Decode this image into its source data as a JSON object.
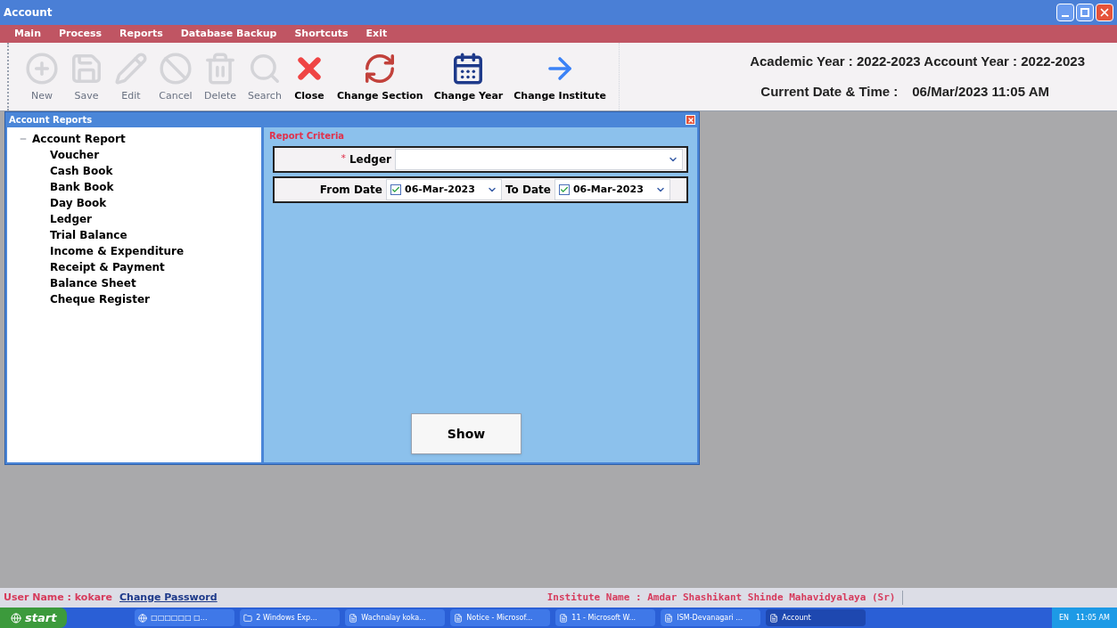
{
  "window": {
    "title": "Account"
  },
  "menu": [
    "Main",
    "Process",
    "Reports",
    "Database Backup",
    "Shortcuts",
    "Exit"
  ],
  "toolbar": [
    {
      "kind": "new",
      "label": "New",
      "disabled": true
    },
    {
      "kind": "save",
      "label": "Save",
      "disabled": true
    },
    {
      "kind": "edit",
      "label": "Edit",
      "disabled": true
    },
    {
      "kind": "cancel",
      "label": "Cancel",
      "disabled": true
    },
    {
      "kind": "delete",
      "label": "Delete",
      "disabled": true
    },
    {
      "kind": "search",
      "label": "Search",
      "disabled": true
    },
    {
      "kind": "close",
      "label": "Close",
      "disabled": false
    },
    {
      "kind": "section",
      "label": "Change Section",
      "disabled": false
    },
    {
      "kind": "year",
      "label": "Change Year",
      "disabled": false
    },
    {
      "kind": "institute",
      "label": "Change Institute",
      "disabled": false
    }
  ],
  "info": {
    "line_1": "Academic Year : 2022-2023 Account Year : 2022-2023",
    "date_label": "Current Date & Time :",
    "date_value": "06/Mar/2023 11:05 AM"
  },
  "child_window": {
    "title": "Account Reports",
    "tree": [
      {
        "label": "Account Report",
        "expanded": true,
        "children": [
          {
            "label": "Voucher"
          },
          {
            "label": "Cash Book"
          },
          {
            "label": "Bank Book"
          },
          {
            "label": "Day Book"
          },
          {
            "label": "Ledger"
          },
          {
            "label": "Trial Balance"
          },
          {
            "label": "Income & Expenditure"
          },
          {
            "label": "Receipt & Payment"
          },
          {
            "label": "Balance Sheet"
          },
          {
            "label": "Cheque Register"
          }
        ]
      }
    ],
    "criteria": {
      "title": "Report Criteria",
      "ledger_label": "Ledger",
      "ledger_required": true,
      "required_mark": "*",
      "from_label": "From Date",
      "from_checked": true,
      "from_value": "06-Mar-2023",
      "to_label": "To Date",
      "to_checked": true,
      "to_value": "06-Mar-2023"
    },
    "show_button": "Show"
  },
  "status_bar": {
    "user": "User Name : kokare",
    "change_password": "Change Password",
    "institute": "Institute Name : Amdar Shashikant Shinde Mahavidyalaya (Sr)"
  },
  "taskbar": {
    "start": "start",
    "items": [
      {
        "label": "□□□□□□ □...",
        "selected": false
      },
      {
        "label": "2 Windows Exp...",
        "selected": false
      },
      {
        "label": "Wachnalay koka...",
        "selected": false
      },
      {
        "label": "Notice - Microsof...",
        "selected": false
      },
      {
        "label": "11 - Microsoft W...",
        "selected": false
      },
      {
        "label": "ISM-Devanagari ...",
        "selected": false
      },
      {
        "label": "Account",
        "selected": true
      }
    ],
    "lang": "EN",
    "time": "11:05 AM"
  }
}
